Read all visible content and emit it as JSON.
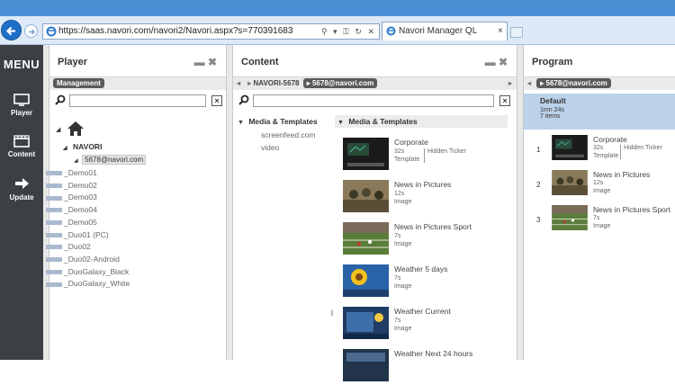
{
  "browser": {
    "url": "https://saas.navori.com/navori2/Navori.aspx?s=770391683",
    "tab_title": "Navori Manager QL",
    "tab_close": "×"
  },
  "sidebar": {
    "title": "MENU",
    "items": [
      {
        "label": "Player",
        "icon": "monitor-icon"
      },
      {
        "label": "Content",
        "icon": "film-clapper-icon"
      },
      {
        "label": "Update",
        "icon": "arrow-right-icon"
      }
    ]
  },
  "player": {
    "title": "Player",
    "badge": "Management",
    "tree": {
      "root_icon": "home-icon",
      "group": "NAVORI",
      "account": "5678@navori.com",
      "players": [
        "_Demo01",
        "_Demo02",
        "_Demo03",
        "_Demo04",
        "_Demo05",
        "_Duo01 (PC)",
        "_Duo02",
        "_Duo02-Android",
        "_DuoGalaxy_Black",
        "_DuoGalaxy_White"
      ]
    }
  },
  "content": {
    "title": "Content",
    "crumb": "NAVORI-5678",
    "crumb_pill": "5678@navori.com",
    "left_tree": {
      "header": "Media & Templates",
      "items": [
        "screenfeed.com",
        "video"
      ]
    },
    "right_header": "Media & Templates",
    "items": [
      {
        "name": "Corporate",
        "duration": "32s",
        "type": "Template",
        "extra": "Hidden Ticker"
      },
      {
        "name": "News in Pictures",
        "duration": "12s",
        "type": "Image"
      },
      {
        "name": "News in Pictures Sport",
        "duration": "7s",
        "type": "Image"
      },
      {
        "name": "Weather 5 days",
        "duration": "7s",
        "type": "Image"
      },
      {
        "name": "Weather Current",
        "duration": "7s",
        "type": "Image"
      },
      {
        "name": "Weather Next 24 hours",
        "duration": "",
        "type": ""
      }
    ]
  },
  "program": {
    "title": "Program",
    "pill": "5678@navori.com",
    "default": {
      "name": "Default",
      "duration": "1mn 24s",
      "count": "7 items"
    },
    "items": [
      {
        "num": "1",
        "name": "Corporate",
        "duration": "32s",
        "type": "Template",
        "extra": "Hidden Ticker"
      },
      {
        "num": "2",
        "name": "News in Pictures",
        "duration": "12s",
        "type": "Image"
      },
      {
        "num": "3",
        "name": "News in Pictures Sport",
        "duration": "7s",
        "type": "Image"
      }
    ]
  },
  "colors": {
    "sidebar": "#3c4045",
    "highlight": "#bcd2ea",
    "browser_blue": "#4a8fd4"
  }
}
